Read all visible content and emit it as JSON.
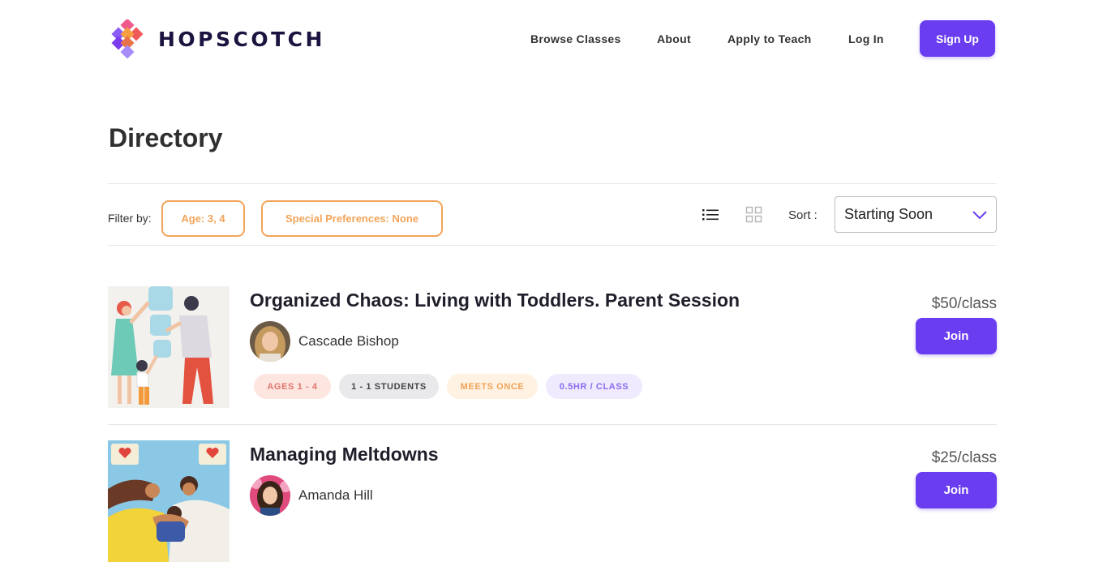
{
  "brand": {
    "name": "HOPSCOTCH"
  },
  "nav": {
    "items": [
      {
        "label": "Browse Classes"
      },
      {
        "label": "About"
      },
      {
        "label": "Apply to Teach"
      },
      {
        "label": "Log In"
      }
    ],
    "signup_label": "Sign Up"
  },
  "page": {
    "title": "Directory"
  },
  "filters": {
    "label": "Filter by:",
    "age": "Age: 3, 4",
    "preferences": "Special Preferences: None"
  },
  "view_toggle": {
    "list_icon": "list-view-icon",
    "grid_icon": "grid-view-icon",
    "selected": "list"
  },
  "sort": {
    "label": "Sort :",
    "value": "Starting Soon",
    "icon": "chevron-down-icon"
  },
  "classes": [
    {
      "title": "Organized Chaos: Living with Toddlers. Parent Session",
      "teacher": "Cascade Bishop",
      "price": "$50/class",
      "join_label": "Join",
      "tags": [
        "AGES 1 - 4",
        "1 - 1 STUDENTS",
        "MEETS ONCE",
        "0.5HR / CLASS"
      ]
    },
    {
      "title": "Managing Meltdowns",
      "teacher": "Amanda Hill",
      "price": "$25/class",
      "join_label": "Join",
      "tags": []
    }
  ],
  "colors": {
    "accent": "#6a3ef0",
    "filter_orange": "#f2a45a",
    "tag_ages_bg": "#fde6e0",
    "tag_ages_fg": "#e0746c",
    "tag_students_bg": "#e9e9ec",
    "tag_students_fg": "#444444",
    "tag_meets_bg": "#fff2e2",
    "tag_meets_fg": "#f0a35a",
    "tag_hours_bg": "#efeafd",
    "tag_hours_fg": "#8b6bf0"
  }
}
